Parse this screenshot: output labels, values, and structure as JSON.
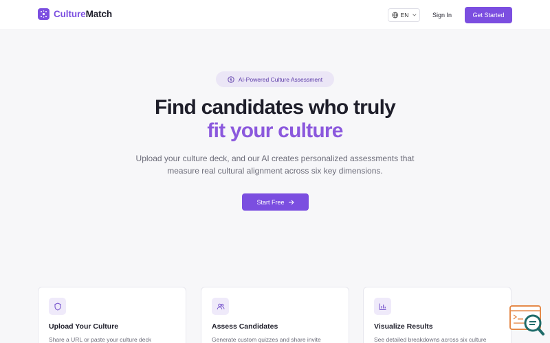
{
  "header": {
    "logo_part1": "Culture",
    "logo_part2": "Match",
    "language": "EN",
    "sign_in": "Sign In",
    "get_started": "Get Started"
  },
  "hero": {
    "badge": "AI-Powered Culture Assessment",
    "title_line1": "Find candidates who truly",
    "title_line2": "fit your culture",
    "subtitle_line1": "Upload your culture deck, and our AI creates personalized assessments that",
    "subtitle_line2": "measure real cultural alignment across six key dimensions.",
    "cta": "Start Free"
  },
  "features": [
    {
      "icon": "shield-icon",
      "title": "Upload Your Culture",
      "description": "Share a URL or paste your culture deck"
    },
    {
      "icon": "users-icon",
      "title": "Assess Candidates",
      "description": "Generate custom quizzes and share invite"
    },
    {
      "icon": "bar-chart-icon",
      "title": "Visualize Results",
      "description": "See detailed breakdowns across six culture"
    }
  ],
  "colors": {
    "brand": "#7b4ee0",
    "brand_light": "#8b58dd",
    "background": "#f7f7f9"
  }
}
